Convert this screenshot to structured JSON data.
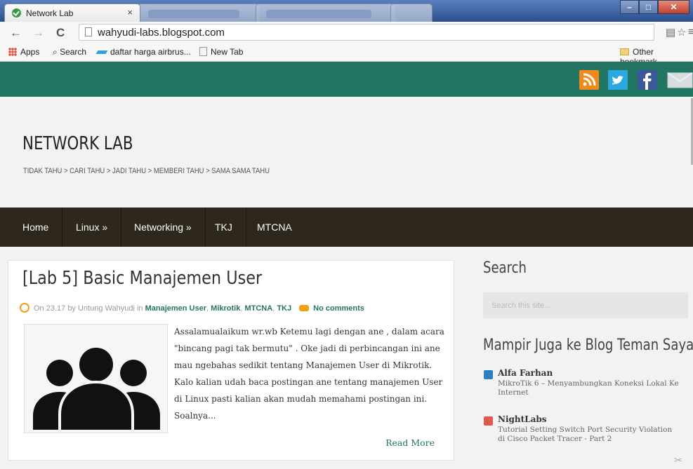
{
  "browser": {
    "active_tab_title": "Network Lab",
    "close_glyph": "×",
    "url": "wahyudi-labs.blogspot.com",
    "bookmarks": [
      "Apps",
      "Search",
      "daftar harga airbrus...",
      "New Tab"
    ],
    "other_bookmarks": "Other bookmark"
  },
  "site": {
    "title": "NETWORK LAB",
    "tagline": "TIDAK TAHU > CARI TAHU > JADI TAHU > MEMBERI TAHU > SAMA SAMA TAHU",
    "menu": [
      "Home",
      "Linux »",
      "Networking »",
      "TKJ",
      "MTCNA"
    ],
    "social_icons": [
      "rss-icon",
      "twitter-icon",
      "facebook-icon",
      "mail-icon"
    ],
    "colors": {
      "topbar": "#227562",
      "menubar": "#2d271c",
      "accent": "#f2a012"
    }
  },
  "post": {
    "title": "[Lab 5] Basic Manajemen User",
    "meta_prefix": "On 23.17 by Untung Wahyudi in",
    "categories": [
      "Manajemen User",
      "Mikrotik",
      "MTCNA",
      "TKJ"
    ],
    "comments": "No comments",
    "excerpt": "Assalamualaikum wr.wb Ketemu lagi dengan ane , dalam acara \"bincang pagi tak bermutu\" . Oke jadi di perbincangan ini ane mau ngebahas sedikit tentang Manajemen User di Mikrotik. Kalo kalian udah baca postingan ane tentang manajemen User di Linux pasti kalian akan mudah memahami postingan ini. Soalnya...",
    "read_more": "Read More"
  },
  "sidebar": {
    "search_title": "Search",
    "search_placeholder": "Search this site...",
    "blogs_title": "Mampir Juga ke Blog Teman Saya",
    "blogs": [
      {
        "name": "Alfa Farhan",
        "post": "MikroTik 6 – Menyambungkan Koneksi Lokal Ke Internet"
      },
      {
        "name": "NightLabs",
        "post": "Tutorial Setting Switch Port Security Violation di Cisco Packet Tracer - Part 2"
      }
    ]
  }
}
